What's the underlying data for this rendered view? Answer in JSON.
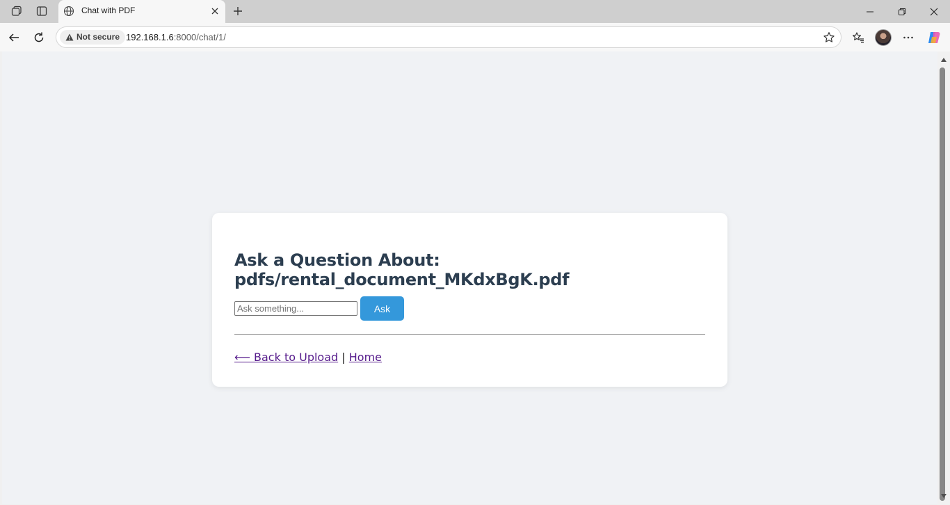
{
  "browser": {
    "tab_title": "Chat with PDF",
    "security_label": "Not secure",
    "url_host": "192.168.1.6",
    "url_rest": ":8000/chat/1/"
  },
  "page": {
    "heading": "Ask a Question About: pdfs/rental_document_MKdxBgK.pdf",
    "question_placeholder": "Ask something...",
    "question_value": "",
    "ask_label": "Ask",
    "back_link": "⟵ Back to Upload",
    "separator": "|",
    "home_link": "Home"
  },
  "colors": {
    "accent": "#3498db",
    "heading": "#2c3e50",
    "page_bg": "#f0f2f5",
    "visited_link": "#551a8b"
  }
}
